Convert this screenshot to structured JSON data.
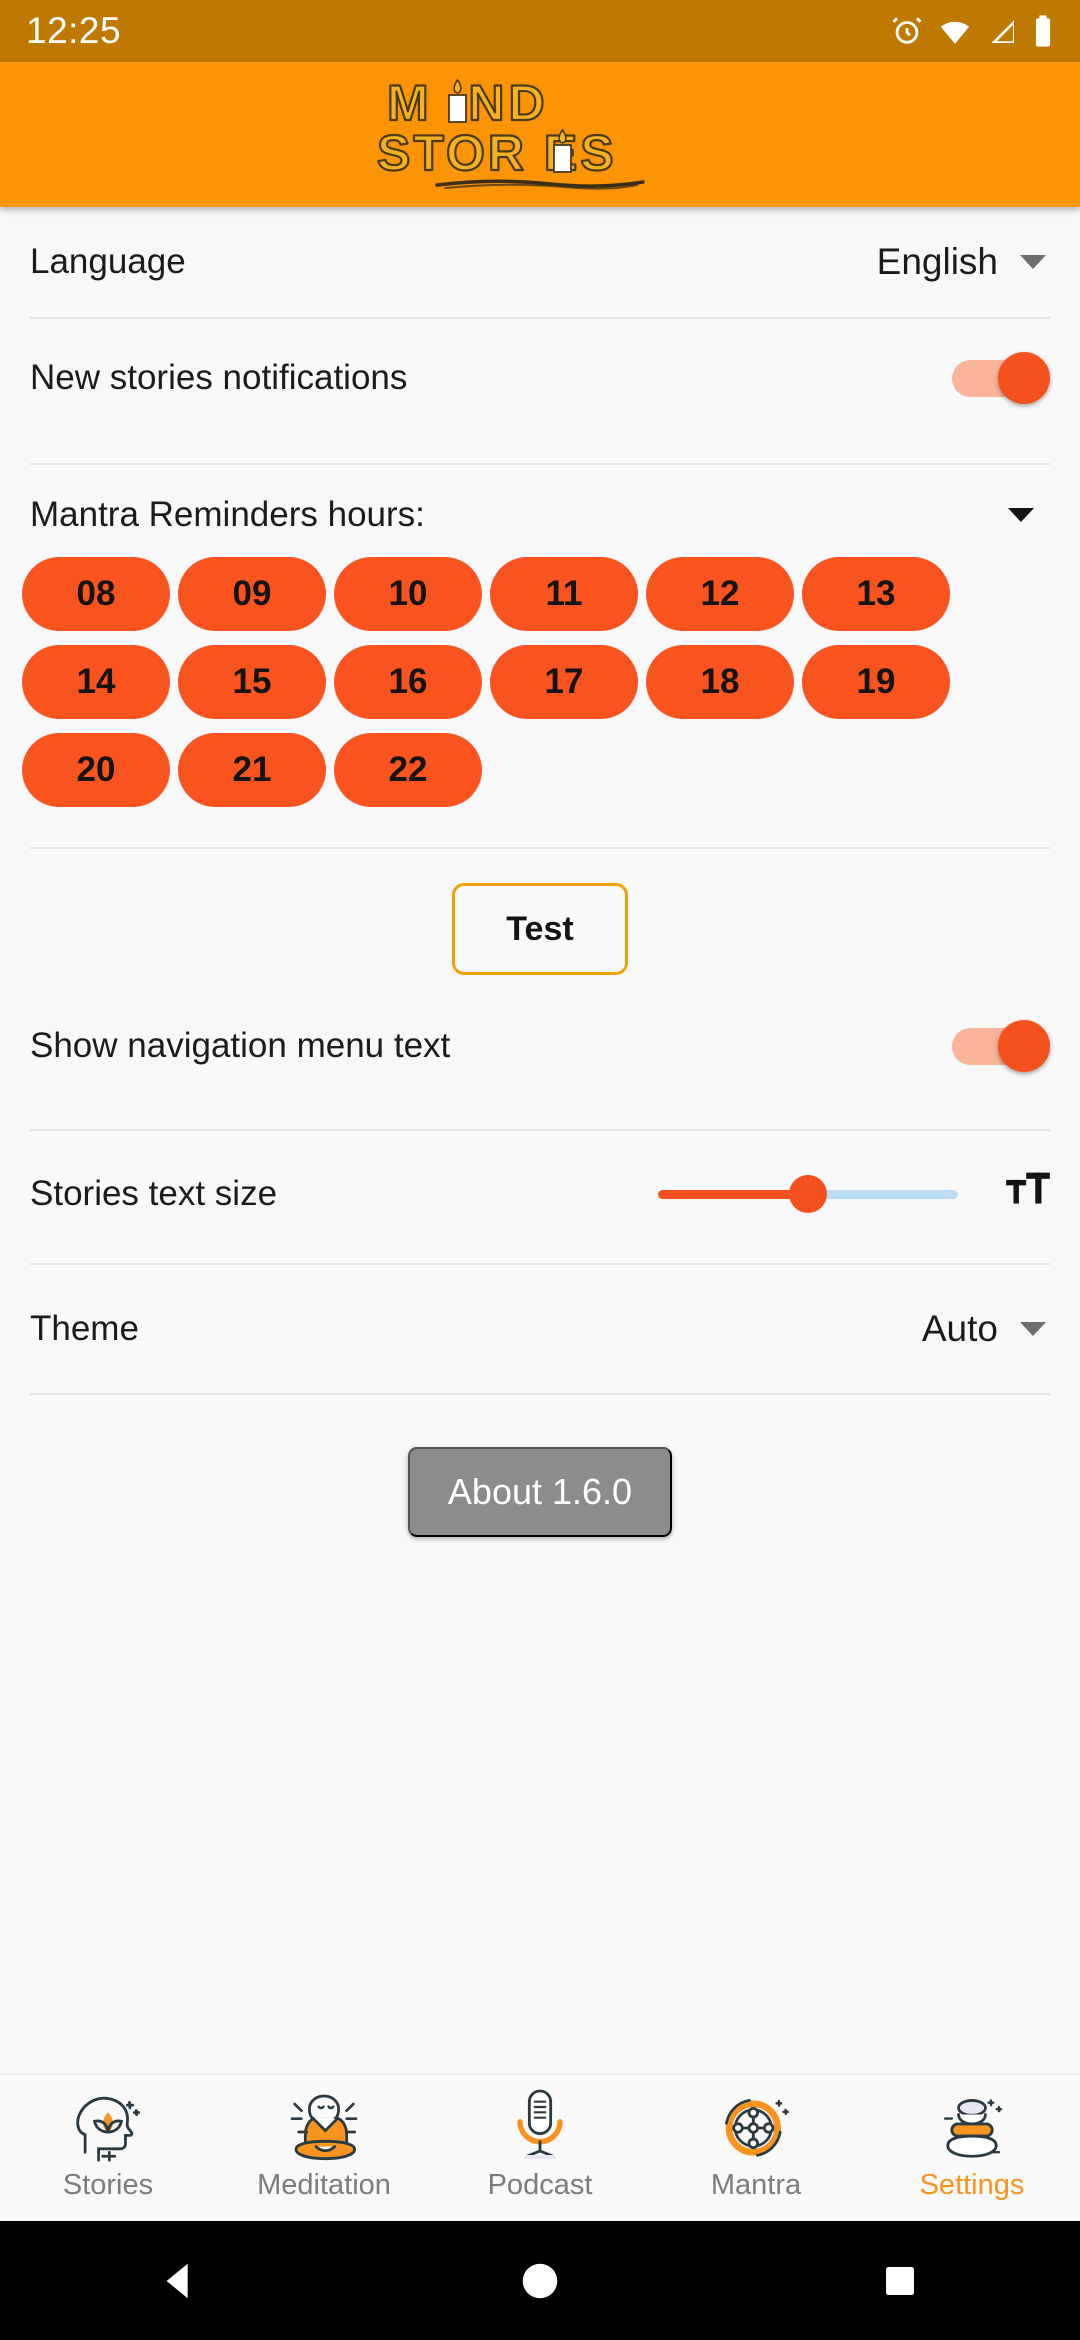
{
  "statusbar": {
    "time": "12:25",
    "icons": [
      "alarm-icon",
      "wifi-icon",
      "signal-icon",
      "battery-icon"
    ]
  },
  "appbar": {
    "logo_line1": "MIND",
    "logo_line2": "STORIES",
    "logo_color": "#F6B221",
    "bar_color": "#FC9405"
  },
  "settings": {
    "language": {
      "label": "Language",
      "value": "English"
    },
    "notifications": {
      "label": "New stories notifications",
      "enabled": true
    },
    "mantra": {
      "label": "Mantra Reminders hours:",
      "hours": [
        [
          "08",
          "09",
          "10",
          "11",
          "12",
          "13"
        ],
        [
          "14",
          "15",
          "16",
          "17",
          "18",
          "19"
        ],
        [
          "20",
          "21",
          "22"
        ]
      ],
      "chip_color": "#F9541F"
    },
    "test": {
      "label": "Test"
    },
    "nav_menu_text": {
      "label": "Show navigation menu text",
      "enabled": true
    },
    "text_size": {
      "label": "Stories text size",
      "icon": "text-size-icon",
      "percent": 50
    },
    "theme": {
      "label": "Theme",
      "value": "Auto"
    },
    "about": {
      "label": "About 1.6.0"
    }
  },
  "bottom_nav": {
    "items": [
      {
        "label": "Stories",
        "icon": "head-lotus-icon",
        "active": false
      },
      {
        "label": "Meditation",
        "icon": "meditating-monk-icon",
        "active": false
      },
      {
        "label": "Podcast",
        "icon": "microphone-icon",
        "active": false
      },
      {
        "label": "Mantra",
        "icon": "mantra-wheel-icon",
        "active": false
      },
      {
        "label": "Settings",
        "icon": "zen-stones-icon",
        "active": true
      }
    ],
    "active_color": "#F7931E"
  },
  "android_nav": {
    "back": "back-button",
    "home": "home-button",
    "recents": "recents-button"
  }
}
